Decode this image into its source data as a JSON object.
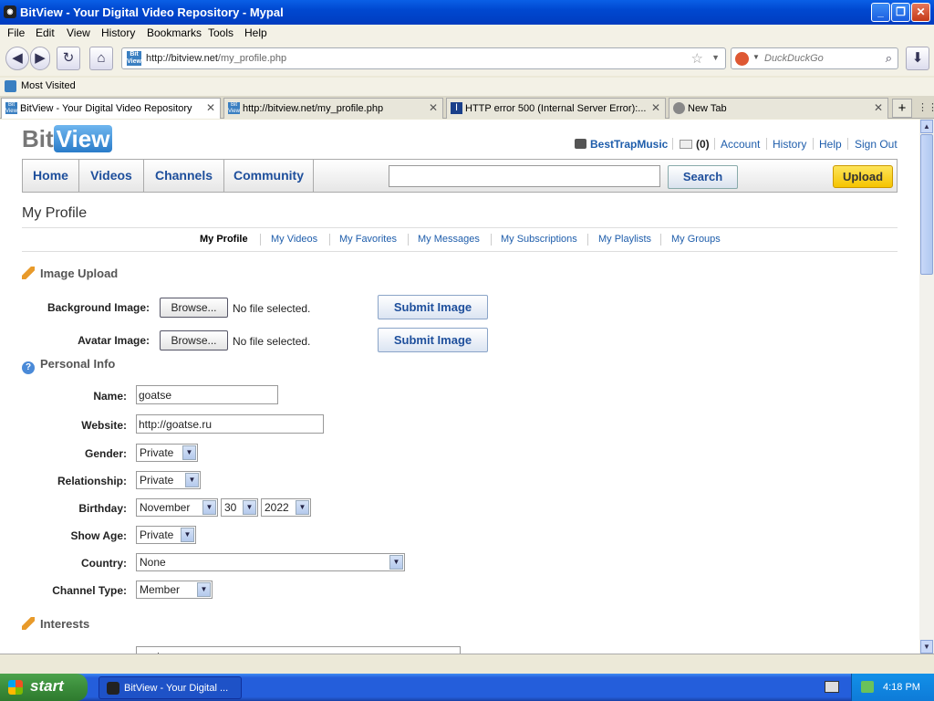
{
  "window": {
    "title": "BitView - Your Digital Video Repository - Mypal",
    "min": "_",
    "max": "❐",
    "close": "✕"
  },
  "menu": [
    "File",
    "Edit",
    "View",
    "History",
    "Bookmarks",
    "Tools",
    "Help"
  ],
  "navbar": {
    "url_domain": "http://bitview.net",
    "url_path": "/my_profile.php",
    "search_placeholder": "DuckDuckGo"
  },
  "bookmarks": {
    "most_visited": "Most Visited"
  },
  "tabs": [
    {
      "label": "BitView - Your Digital Video Repository"
    },
    {
      "label": "http://bitview.net/my_profile.php"
    },
    {
      "label": "HTTP error 500 (Internal Server Error):..."
    },
    {
      "label": "New Tab"
    }
  ],
  "site": {
    "logo_a": "Bit",
    "logo_b": "View",
    "username": "BestTrapMusic",
    "msg_count": "(0)",
    "links": [
      "Account",
      "History",
      "Help",
      "Sign Out"
    ],
    "nav": [
      "Home",
      "Videos",
      "Channels",
      "Community"
    ],
    "search_btn": "Search",
    "upload_btn": "Upload"
  },
  "page": {
    "title": "My Profile",
    "subnav": [
      "My Profile",
      "My Videos",
      "My Favorites",
      "My Messages",
      "My Subscriptions",
      "My Playlists",
      "My Groups"
    ],
    "image_upload": {
      "heading": "Image Upload",
      "bg_label": "Background Image:",
      "avatar_label": "Avatar Image:",
      "browse": "Browse...",
      "no_file": "No file selected.",
      "submit": "Submit Image"
    },
    "personal": {
      "heading": "Personal Info",
      "name_label": "Name:",
      "name": "goatse",
      "website_label": "Website:",
      "website": "http://goatse.ru",
      "gender_label": "Gender:",
      "gender": "Private",
      "relationship_label": "Relationship:",
      "relationship": "Private",
      "birthday_label": "Birthday:",
      "bday_month": "November",
      "bday_day": "30",
      "bday_year": "2022",
      "showage_label": "Show Age:",
      "showage": "Private",
      "country_label": "Country:",
      "country": "None",
      "channel_label": "Channel Type:",
      "channel": "Member"
    },
    "interests": {
      "heading": "Interests",
      "value": "goatse"
    }
  },
  "taskbar": {
    "start": "start",
    "item": "BitView - Your Digital ...",
    "time": "4:18 PM"
  },
  "colors": {
    "link": "#1e5dab",
    "upload": "#f5c400",
    "xp_blue": "#245edb"
  }
}
